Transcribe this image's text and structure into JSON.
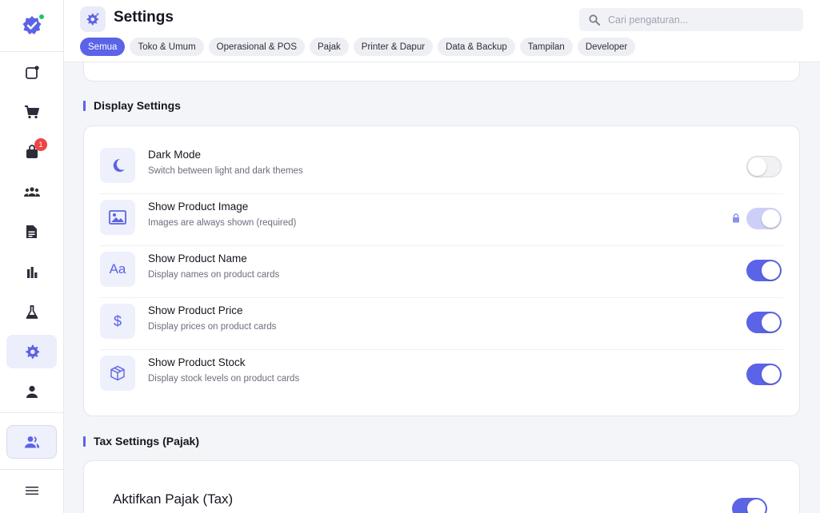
{
  "sidebar": {
    "items": [
      {
        "icon": "new-order-icon"
      },
      {
        "icon": "cart-icon"
      },
      {
        "icon": "bag-icon",
        "badge": "1"
      },
      {
        "icon": "group-icon"
      },
      {
        "icon": "document-icon"
      },
      {
        "icon": "bar-chart-icon"
      },
      {
        "icon": "flask-icon"
      },
      {
        "icon": "gear-icon",
        "active": true
      },
      {
        "icon": "person-icon"
      },
      {
        "icon": "switch-user-icon"
      },
      {
        "icon": "menu-icon"
      }
    ]
  },
  "header": {
    "title": "Settings",
    "search_placeholder": "Cari pengaturan...",
    "tabs": [
      "Semua",
      "Toko & Umum",
      "Operasional & POS",
      "Pajak",
      "Printer & Dapur",
      "Data & Backup",
      "Tampilan",
      "Developer"
    ],
    "active_tab": "Semua"
  },
  "display_settings": {
    "title": "Display Settings",
    "rows": [
      {
        "icon": "moon-icon",
        "label": "Dark Mode",
        "desc": "Switch between light and dark themes",
        "on": false,
        "locked": false
      },
      {
        "icon": "image-icon",
        "label": "Show Product Image",
        "desc": "Images are always shown (required)",
        "on": true,
        "locked": true
      },
      {
        "icon": "font-icon",
        "glyph": "Aa",
        "label": "Show Product Name",
        "desc": "Display names on product cards",
        "on": true,
        "locked": false
      },
      {
        "icon": "dollar-icon",
        "glyph": "$",
        "label": "Show Product Price",
        "desc": "Display prices on product cards",
        "on": true,
        "locked": false
      },
      {
        "icon": "box-icon",
        "label": "Show Product Stock",
        "desc": "Display stock levels on product cards",
        "on": true,
        "locked": false
      }
    ]
  },
  "tax_settings": {
    "title": "Tax Settings (Pajak)",
    "enable_label": "Aktifkan Pajak (Tax)",
    "enable_on": true
  },
  "colors": {
    "accent": "#5b63e6",
    "accent_soft": "#eef0fb",
    "badge": "#ef4444",
    "online": "#22c55e"
  }
}
